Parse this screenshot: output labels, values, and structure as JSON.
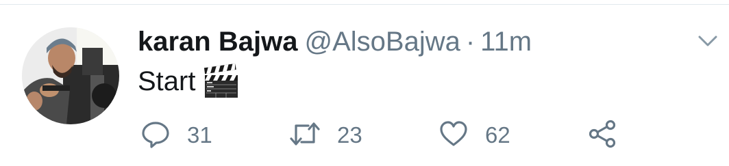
{
  "tweet": {
    "display_name": "karan Bajwa",
    "handle": "@AlsoBajwa",
    "separator": "·",
    "timestamp": "11m",
    "text": "Start",
    "emoji": "clapper-board-icon"
  },
  "actions": {
    "reply_count": "31",
    "retweet_count": "23",
    "like_count": "62"
  },
  "colors": {
    "name": "#14171a",
    "secondary": "#657786",
    "divider": "#e1e8ed"
  }
}
